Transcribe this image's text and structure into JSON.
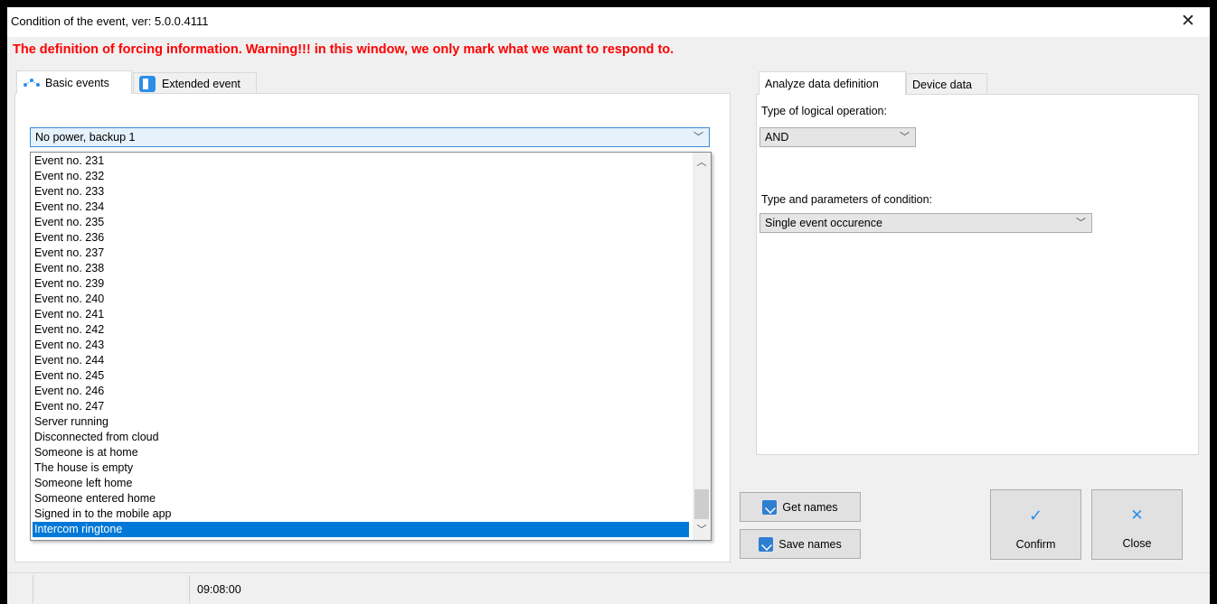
{
  "window": {
    "title": "Condition of the event,  ver: 5.0.0.4111",
    "close_symbol": "✕"
  },
  "warning": "The definition of forcing information. Warning!!! in this window, we only mark what we want to respond to.",
  "left_tabs": [
    {
      "label": "Basic events",
      "icon": "nodes-icon",
      "active": true
    },
    {
      "label": "Extended event",
      "icon": "panel-icon",
      "active": false
    }
  ],
  "event_combo": {
    "value": "No power, backup 1"
  },
  "event_list": {
    "items": [
      "Event no. 231",
      "Event no. 232",
      "Event no. 233",
      "Event no. 234",
      "Event no. 235",
      "Event no. 236",
      "Event no. 237",
      "Event no. 238",
      "Event no. 239",
      "Event no. 240",
      "Event no. 241",
      "Event no. 242",
      "Event no. 243",
      "Event no. 244",
      "Event no. 245",
      "Event no. 246",
      "Event no. 247",
      "Server running",
      "Disconnected from cloud",
      "Someone is at home",
      "The house is empty",
      "Someone left home",
      "Someone entered home",
      "Signed in to the mobile app",
      "Intercom ringtone"
    ],
    "selected_index": 24
  },
  "right_tabs": [
    {
      "label": "Analyze data definition",
      "active": true
    },
    {
      "label": "Device data",
      "active": false
    }
  ],
  "logical_operation": {
    "label": "Type of logical operation:",
    "value": "AND"
  },
  "condition": {
    "label": "Type and parameters of condition:",
    "value": "Single event occurence"
  },
  "buttons": {
    "get_names": "Get names",
    "save_names": "Save names",
    "confirm": "Confirm",
    "close": "Close"
  },
  "status": {
    "time": "09:08:00"
  },
  "colors": {
    "warning": "#ff0000",
    "selection": "#0078d7",
    "accent_icon": "#2a8ee6"
  }
}
